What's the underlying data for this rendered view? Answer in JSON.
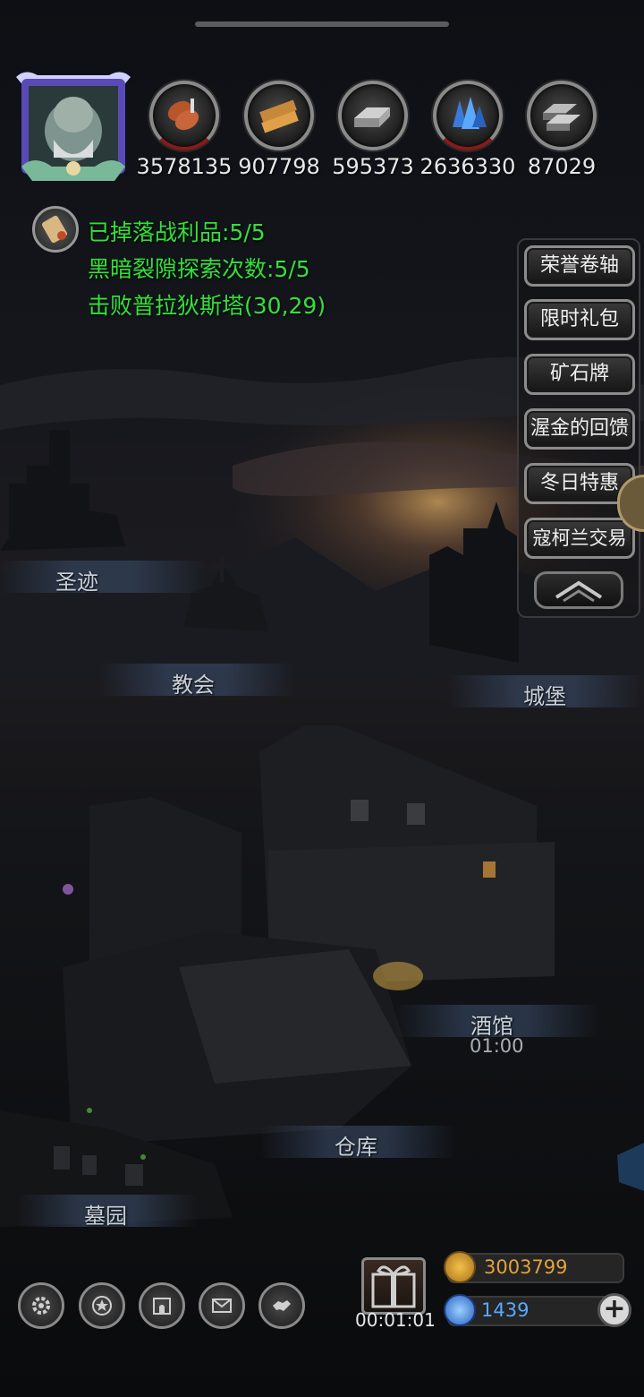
{
  "resources": [
    {
      "icon": "meat-icon",
      "value": "3578135"
    },
    {
      "icon": "wood-plank-icon",
      "value": "907798"
    },
    {
      "icon": "iron-ingot-icon",
      "value": "595373"
    },
    {
      "icon": "blue-crystal-icon",
      "value": "2636330"
    },
    {
      "icon": "metal-bar-icon",
      "value": "87029"
    }
  ],
  "quests": {
    "icon": "scroll-icon",
    "lines": [
      "已掉落战利品:5/5",
      "黑暗裂隙探索次数:5/5",
      "击败普拉狄斯塔(30,29)"
    ]
  },
  "side_menu": {
    "items": [
      "荣誉卷轴",
      "限时礼包",
      "矿石牌",
      "渥金的回馈",
      "冬日特惠",
      "寇柯兰交易"
    ],
    "collapse_icon": "chevron-up-icon"
  },
  "locations": {
    "shrine": "圣迹",
    "church": "教会",
    "castle": "城堡",
    "tavern": "酒馆",
    "tavern_timer": "01:00",
    "warehouse": "仓库",
    "graveyard": "墓园"
  },
  "bottom": {
    "buttons": [
      "gear-icon",
      "star-badge-icon",
      "castle-gate-icon",
      "mail-icon",
      "handshake-icon"
    ],
    "gift_timer": "00:01:01",
    "gold": "3003799",
    "gems": "1439"
  },
  "colors": {
    "quest_text": "#34e03a",
    "gold_text": "#e2a23a",
    "gem_text": "#5aa8ff"
  }
}
